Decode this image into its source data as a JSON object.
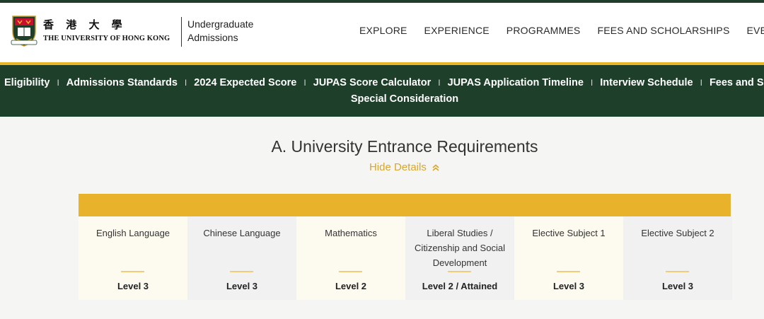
{
  "header": {
    "logo_cn": "香 港 大 學",
    "logo_en": "THE UNIVERSITY OF HONG KONG",
    "subtitle_line1": "Undergraduate",
    "subtitle_line2": "Admissions"
  },
  "nav": {
    "items": [
      {
        "label": "EXPLORE"
      },
      {
        "label": "EXPERIENCE"
      },
      {
        "label": "PROGRAMMES"
      },
      {
        "label": "FEES AND SCHOLARSHIPS"
      },
      {
        "label": "EVENTS"
      }
    ]
  },
  "subnav": {
    "items": [
      {
        "label": "Eligibility"
      },
      {
        "label": "Admissions Standards"
      },
      {
        "label": "2024 Expected Score"
      },
      {
        "label": "JUPAS Score Calculator"
      },
      {
        "label": "JUPAS Application Timeline"
      },
      {
        "label": "Interview Schedule"
      },
      {
        "label": "Fees and Scholarships"
      }
    ],
    "row2": "Special Consideration",
    "separator": "I"
  },
  "main": {
    "title": "A. University Entrance Requirements",
    "toggle_label": "Hide Details"
  },
  "requirements": [
    {
      "subject": "English Language",
      "level": "Level 3"
    },
    {
      "subject": "Chinese Language",
      "level": "Level 3"
    },
    {
      "subject": "Mathematics",
      "level": "Level 2"
    },
    {
      "subject": "Liberal Studies / Citizenship and Social Development",
      "level": "Level 2 / Attained"
    },
    {
      "subject": "Elective Subject 1",
      "level": "Level 3"
    },
    {
      "subject": "Elective Subject 2",
      "level": "Level 3"
    }
  ],
  "colors": {
    "dark_green": "#1e402b",
    "gold": "#e8b22a",
    "toggle_gold": "#d9a52d"
  },
  "icons": {
    "crest": "university-crest-icon",
    "toggle": "double-chevron-up-icon"
  }
}
